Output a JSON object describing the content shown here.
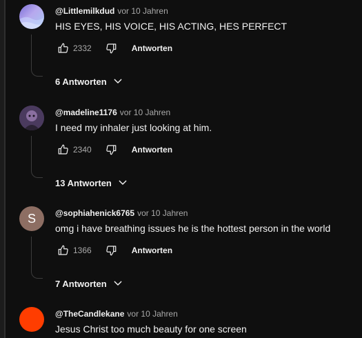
{
  "comments": [
    {
      "author": "@Littlemilkdud",
      "time": "vor 10 Jahren",
      "text": "HIS EYES, HIS VOICE, HIS ACTING, HES PERFECT",
      "likes": "2332",
      "reply_label": "Antworten",
      "replies_label": "6 Antworten",
      "avatar_colors": [
        "#7b6fd6",
        "#a6c8f2"
      ]
    },
    {
      "author": "@madeline1176",
      "time": "vor 10 Jahren",
      "text": "I need my inhaler just looking at him.",
      "likes": "2340",
      "reply_label": "Antworten",
      "replies_label": "13 Antworten",
      "avatar_colors": [
        "#4a3a5e",
        "#8a6fa0"
      ]
    },
    {
      "author": "@sophiahenick6765",
      "time": "vor 10 Jahren",
      "text": "omg i have breathing issues he is the hottest person in the world",
      "likes": "1366",
      "reply_label": "Antworten",
      "replies_label": "7 Antworten",
      "avatar_letter": "S",
      "avatar_colors": [
        "#8d6e63"
      ]
    },
    {
      "author": "@TheCandlekane",
      "time": "vor 10 Jahren",
      "text": "Jesus Christ too much beauty for one screen",
      "avatar_colors": [
        "#ff3d00"
      ]
    }
  ],
  "icons": {
    "like": "thumb-up-icon",
    "dislike": "thumb-down-icon",
    "expand": "chevron-down-icon"
  }
}
